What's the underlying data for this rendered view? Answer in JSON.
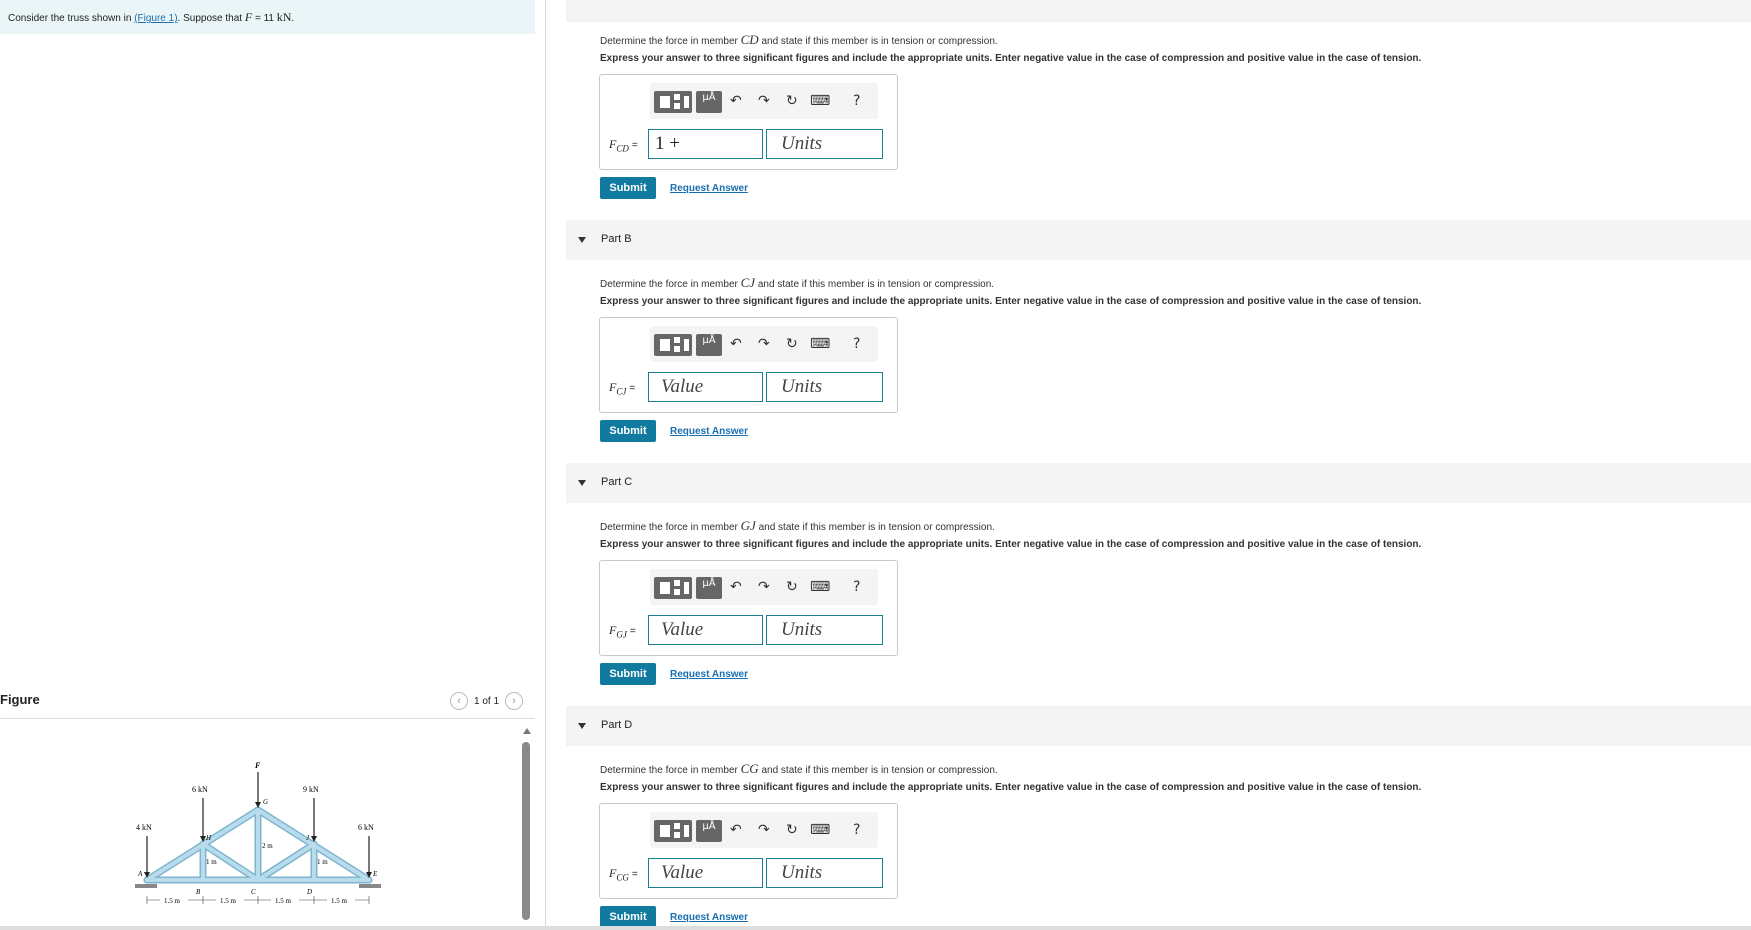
{
  "intro": {
    "prefix": "Consider the truss shown in",
    "link": "(Figure 1)",
    "mid": ". Suppose that",
    "var": "F",
    "eq": "= 11",
    "unit": "kN",
    "end": "."
  },
  "figure": {
    "title": "Figure",
    "pager": "1 of 1",
    "loads": {
      "a": "4 kN",
      "h": "6 kN",
      "f": "F",
      "j": "9 kN",
      "e": "6 kN"
    },
    "nodes": {
      "A": "A",
      "B": "B",
      "C": "C",
      "D": "D",
      "E": "E",
      "F": "F",
      "G": "G",
      "H": "H",
      "J": "J"
    },
    "dims": {
      "d1": "1.5 m",
      "d2": "1.5 m",
      "d3": "1.5 m",
      "d4": "1.5 m",
      "h1": "1 m",
      "h2": "2 m",
      "h3": "1 m"
    }
  },
  "parts": [
    {
      "label": "",
      "q_pre": "Determine the force in member",
      "member": "CD",
      "q_post": "and state if this member is in tension or compression.",
      "instructions": "Express your answer to three significant figures and include the appropriate units. Enter negative value in the case of compression and positive value in the case of tension.",
      "var": "F",
      "sub": "CD",
      "value": "1 +",
      "units_placeholder": "Units",
      "submit": "Submit",
      "request": "Request Answer"
    },
    {
      "label": "Part B",
      "q_pre": "Determine the force in member",
      "member": "CJ",
      "q_post": "and state if this member is in tension or compression.",
      "instructions": "Express your answer to three significant figures and include the appropriate units. Enter negative value in the case of compression and positive value in the case of tension.",
      "var": "F",
      "sub": "CJ",
      "value": "Value",
      "units_placeholder": "Units",
      "submit": "Submit",
      "request": "Request Answer"
    },
    {
      "label": "Part C",
      "q_pre": "Determine the force in member",
      "member": "GJ",
      "q_post": "and state if this member is in tension or compression.",
      "instructions": "Express your answer to three significant figures and include the appropriate units. Enter negative value in the case of compression and positive value in the case of tension.",
      "var": "F",
      "sub": "GJ",
      "value": "Value",
      "units_placeholder": "Units",
      "submit": "Submit",
      "request": "Request Answer"
    },
    {
      "label": "Part D",
      "q_pre": "Determine the force in member",
      "member": "CG",
      "q_post": "and state if this member is in tension or compression.",
      "instructions": "Express your answer to three significant figures and include the appropriate units. Enter negative value in the case of compression and positive value in the case of tension.",
      "var": "F",
      "sub": "CG",
      "value": "Value",
      "units_placeholder": "Units",
      "submit": "Submit",
      "request": "Request Answer"
    }
  ],
  "toolbar": {
    "mu": "μÅ",
    "undo": "↶",
    "redo": "↷",
    "reset": "↻",
    "keyboard": "⌨",
    "help": "?"
  },
  "colors": {
    "accent": "#117a9f",
    "intro_bg": "#e9f5f6",
    "truss_fill": "#a9d3e6"
  }
}
